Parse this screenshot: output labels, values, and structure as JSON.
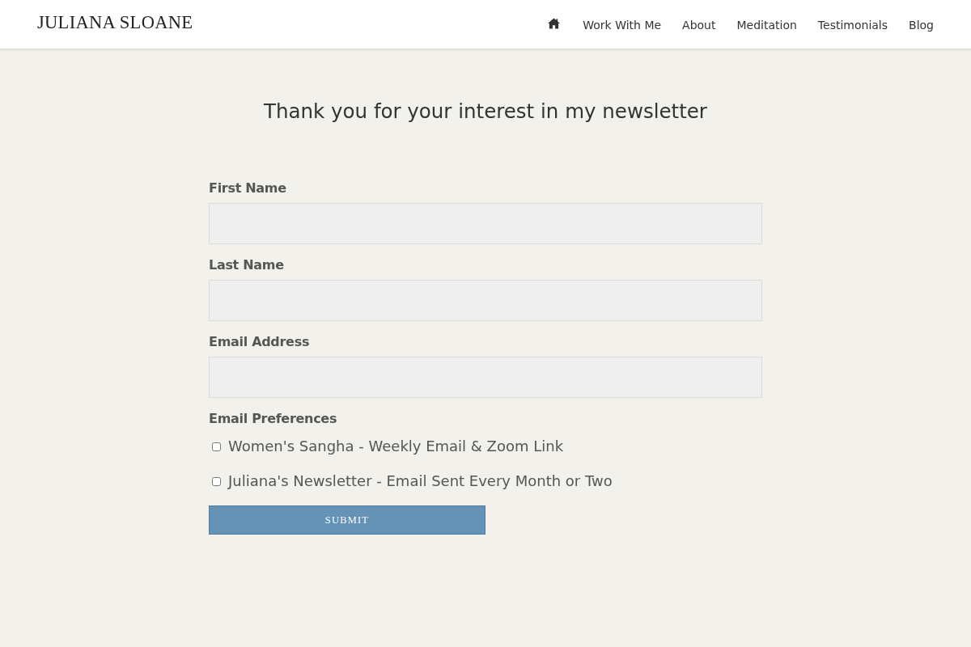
{
  "header": {
    "logo": "JULIANA SLOANE",
    "nav": [
      {
        "kind": "icon"
      },
      {
        "kind": "link",
        "label": "Work With Me"
      },
      {
        "kind": "link",
        "label": "About"
      },
      {
        "kind": "link",
        "label": "Meditation"
      },
      {
        "kind": "link",
        "label": "Testimonials"
      },
      {
        "kind": "link",
        "label": "Blog"
      }
    ]
  },
  "form": {
    "title": "Thank you for your interest in my newsletter",
    "fields": [
      {
        "label": "First Name"
      },
      {
        "label": "Last Name"
      },
      {
        "label": "Email Address"
      }
    ],
    "preferences": {
      "label": "Email Preferences",
      "options": [
        {
          "label": "Women's Sangha - Weekly Email & Zoom Link",
          "checked": false
        },
        {
          "label": "Juliana's Newsletter - Email Sent Every Month or Two",
          "checked": false
        }
      ]
    },
    "submit": "SUBMIT"
  }
}
